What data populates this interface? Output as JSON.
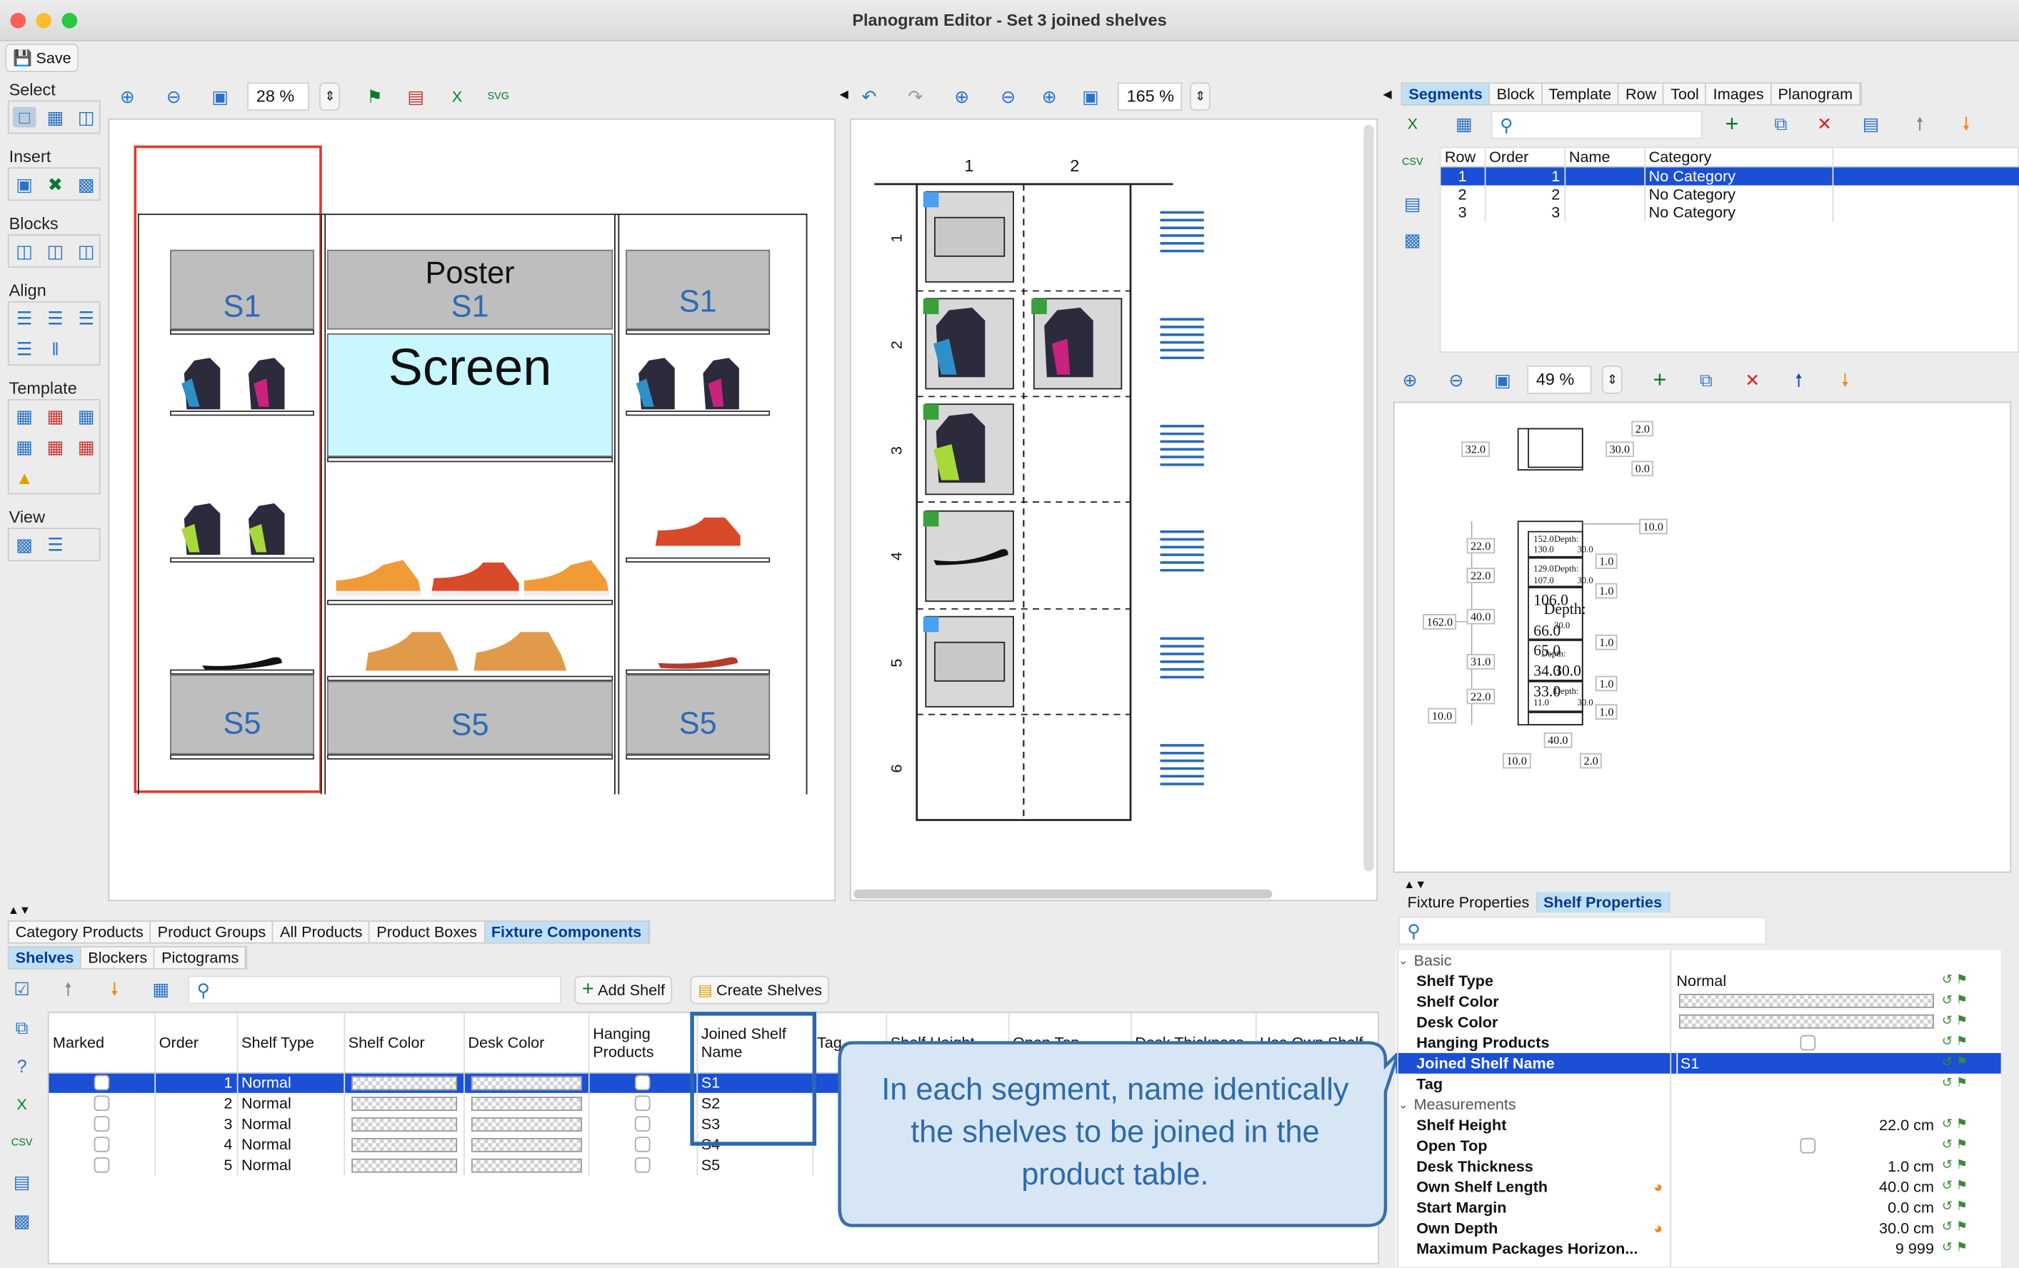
{
  "window": {
    "title": "Planogram Editor - Set 3 joined shelves"
  },
  "toolbar": {
    "save_label": "Save"
  },
  "left_palette": {
    "sections": [
      "Select",
      "Insert",
      "Blocks",
      "Align",
      "Template",
      "View"
    ]
  },
  "canvas_left": {
    "zoom": "28 %",
    "labels": {
      "s1_a": "S1",
      "poster": "Poster",
      "s1_b": "S1",
      "screen": "Screen",
      "s1_c": "S1",
      "s5_a": "S5",
      "s5_b": "S5",
      "s5_c": "S5"
    }
  },
  "canvas_mid": {
    "zoom": "165 %",
    "columns": [
      "1",
      "2"
    ],
    "rows": [
      "1",
      "2",
      "3",
      "4",
      "5",
      "6"
    ]
  },
  "right_top": {
    "tabs": [
      "Segments",
      "Block",
      "Template",
      "Row",
      "Tool",
      "Images",
      "Planogram"
    ],
    "table": {
      "headers": [
        "Row",
        "Order",
        "Name",
        "Category"
      ],
      "rows": [
        [
          "1",
          "1",
          "",
          "No Category"
        ],
        [
          "2",
          "2",
          "",
          "No Category"
        ],
        [
          "3",
          "3",
          "",
          "No Category"
        ]
      ]
    }
  },
  "right_mid": {
    "zoom": "49 %",
    "dims": [
      "2.0",
      "32.0",
      "30.0",
      "0.0",
      "10.0",
      "22.0",
      "22.0",
      "40.0",
      "31.0",
      "22.0",
      "162.0",
      "10.0",
      "1.0",
      "1.0",
      "1.0",
      "1.0",
      "1.0",
      "40.0",
      "10.0",
      "2.0",
      "152.0",
      "130.0",
      "Depth:",
      "30.0",
      "129.0",
      "107.0",
      "Depth:",
      "30.0",
      "106.0",
      "Depth:",
      "66.0",
      "30.0",
      "65.0",
      "Depth:",
      "34.0",
      "30.0",
      "33.0",
      "11.0",
      "Depth:",
      "30.0"
    ]
  },
  "bottom_tabs": [
    "Category Products",
    "Product Groups",
    "All Products",
    "Product Boxes",
    "Fixture Components"
  ],
  "sub_tabs": [
    "Shelves",
    "Blockers",
    "Pictograms"
  ],
  "shelf_toolbar": {
    "add_shelf": "Add Shelf",
    "create_shelves": "Create Shelves"
  },
  "shelf_table": {
    "headers": [
      "Marked",
      "Order",
      "Shelf Type",
      "Shelf Color",
      "Desk Color",
      "Hanging Products",
      "Joined Shelf Name",
      "Tag",
      "Shelf Height",
      "Open Top",
      "Desk Thickness",
      "Use Own Shelf"
    ],
    "rows": [
      [
        "1",
        "Normal",
        "S1"
      ],
      [
        "2",
        "Normal",
        "S2"
      ],
      [
        "3",
        "Normal",
        "S3"
      ],
      [
        "4",
        "Normal",
        "S4"
      ],
      [
        "5",
        "Normal",
        "S5"
      ]
    ]
  },
  "callout": "In each segment, name identically the shelves to be joined in the product table.",
  "props_tabs": [
    "Fixture Properties",
    "Shelf Properties"
  ],
  "props": {
    "basic_title": "Basic",
    "measure_title": "Measurements",
    "basic": [
      [
        "Shelf Type",
        "Normal"
      ],
      [
        "Shelf Color",
        ""
      ],
      [
        "Desk Color",
        ""
      ],
      [
        "Hanging Products",
        ""
      ],
      [
        "Joined Shelf Name",
        "S1"
      ],
      [
        "Tag",
        ""
      ]
    ],
    "measures": [
      [
        "Shelf Height",
        "22.0 cm"
      ],
      [
        "Open Top",
        ""
      ],
      [
        "Desk Thickness",
        "1.0 cm"
      ],
      [
        "Own Shelf Length",
        "40.0 cm"
      ],
      [
        "Start Margin",
        "0.0 cm"
      ],
      [
        "Own Depth",
        "30.0 cm"
      ],
      [
        "Maximum Packages Horizon...",
        "9 999"
      ]
    ]
  }
}
